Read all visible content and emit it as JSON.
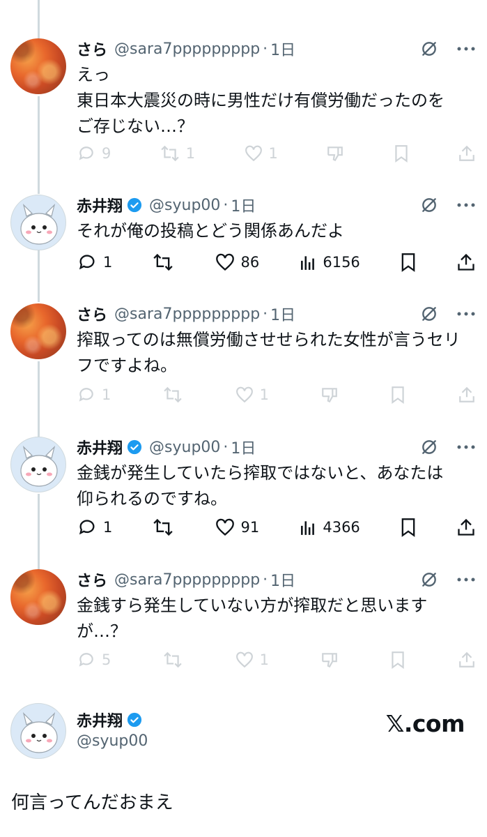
{
  "tweets": [
    {
      "name": "さら",
      "handle": "@sara7ppppppppp",
      "time": "1日",
      "lines": [
        "えっ",
        "東日本大震災の時に男性だけ有償労働だったのを",
        "ご存じない…？"
      ],
      "replies": "9",
      "retweets": "1",
      "likes": "1",
      "views": ""
    },
    {
      "name": "赤井翔",
      "handle": "@syup00",
      "time": "1日",
      "lines": [
        "それが俺の投稿とどう関係あんだよ"
      ],
      "replies": "1",
      "retweets": "",
      "likes": "86",
      "views": "6156"
    },
    {
      "name": "さら",
      "handle": "@sara7ppppppppp",
      "time": "1日",
      "lines": [
        "搾取ってのは無償労働させせられた女性が言うセリ",
        "フですよね。"
      ],
      "replies": "1",
      "retweets": "",
      "likes": "1",
      "views": ""
    },
    {
      "name": "赤井翔",
      "handle": "@syup00",
      "time": "1日",
      "lines": [
        "金銭が発生していたら搾取ではないと、あなたは",
        "仰られるのですね。"
      ],
      "replies": "1",
      "retweets": "",
      "likes": "91",
      "views": "4366"
    },
    {
      "name": "さら",
      "handle": "@sara7ppppppppp",
      "time": "1日",
      "lines": [
        "金銭すら発生していない方が搾取だと思います",
        "が…？"
      ],
      "replies": "5",
      "retweets": "",
      "likes": "1",
      "views": ""
    }
  ],
  "main_post": {
    "name": "赤井翔",
    "handle": "@syup00",
    "text": "何言ってんだおまえ",
    "site": "𝕏.com"
  },
  "dot": "·",
  "colors": {
    "text": "#0f1419",
    "secondary": "#536471",
    "verified": "#1d9bf0",
    "thread_line": "#cfd9de"
  }
}
